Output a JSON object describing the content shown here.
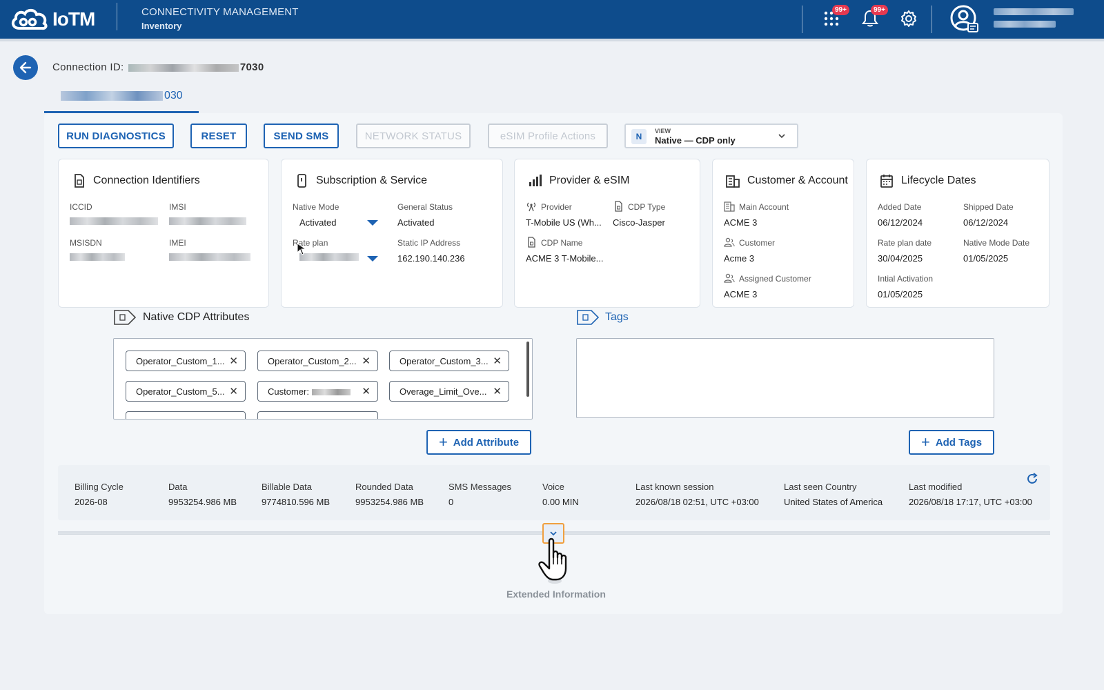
{
  "header": {
    "logo_text": "IoTM",
    "app_title": "CONNECTIVITY MANAGEMENT",
    "app_subtitle": "Inventory",
    "apps_badge": "99+",
    "notifications_badge": "99+",
    "brand_color": "#0e4c8c"
  },
  "page": {
    "connection_label": "Connection ID:",
    "connection_suffix": "7030",
    "tab_suffix": "030"
  },
  "actions": {
    "run_diagnostics": "RUN DIAGNOSTICS",
    "reset": "RESET",
    "send_sms": "SEND SMS",
    "network_status": "NETWORK STATUS",
    "esim_profile_actions": "eSIM Profile Actions",
    "view_badge": "N",
    "view_label": "VIEW",
    "view_value": "Native — CDP only"
  },
  "cards": {
    "identifiers": {
      "title": "Connection Identifiers",
      "iccid_label": "ICCID",
      "imsi_label": "IMSI",
      "msisdn_label": "MSISDN",
      "imei_label": "IMEI"
    },
    "subscription": {
      "title": "Subscription & Service",
      "native_mode_label": "Native Mode",
      "native_mode_value": "Activated",
      "general_status_label": "General Status",
      "general_status_value": "Activated",
      "rate_plan_label": "Rate plan",
      "static_ip_label": "Static IP Address",
      "static_ip_value": "162.190.140.236"
    },
    "provider": {
      "title": "Provider & eSIM",
      "provider_label": "Provider",
      "provider_value": "T-Mobile US (Wh...",
      "cdp_type_label": "CDP Type",
      "cdp_type_value": "Cisco-Jasper",
      "cdp_name_label": "CDP Name",
      "cdp_name_value": "ACME 3 T-Mobile..."
    },
    "customer": {
      "title": "Customer & Account",
      "main_account_label": "Main Account",
      "main_account_value": "ACME 3",
      "customer_label": "Customer",
      "customer_value": "Acme 3",
      "assigned_customer_label": "Assigned Customer",
      "assigned_customer_value": "ACME 3"
    },
    "lifecycle": {
      "title": "Lifecycle Dates",
      "added_date_label": "Added Date",
      "added_date_value": "06/12/2024",
      "shipped_date_label": "Shipped Date",
      "shipped_date_value": "06/12/2024",
      "rate_plan_date_label": "Rate plan date",
      "rate_plan_date_value": "30/04/2025",
      "native_mode_date_label": "Native Mode Date",
      "native_mode_date_value": "01/05/2025",
      "initial_activation_label": "Intial Activation",
      "initial_activation_value": "01/05/2025"
    }
  },
  "attributes": {
    "title": "Native CDP Attributes",
    "chips": [
      "Operator_Custom_1...",
      "Operator_Custom_2...",
      "Operator_Custom_3...",
      "Operator_Custom_5...",
      "Customer:",
      "Overage_Limit_Ove..."
    ],
    "add_label": "Add Attribute"
  },
  "tags": {
    "title": "Tags",
    "add_label": "Add Tags"
  },
  "stats": [
    {
      "label": "Billing Cycle",
      "value": "2026-08"
    },
    {
      "label": "Data",
      "value": "9953254.986 MB"
    },
    {
      "label": "Billable Data",
      "value": "9774810.596 MB"
    },
    {
      "label": "Rounded Data",
      "value": "9953254.986 MB"
    },
    {
      "label": "SMS Messages",
      "value": "0"
    },
    {
      "label": "Voice",
      "value": "0.00 MIN"
    },
    {
      "label": "Last known session",
      "value": "2026/08/18 02:51, UTC +03:00"
    },
    {
      "label": "Last seen Country",
      "value": "United States of America"
    },
    {
      "label": "Last modified",
      "value": "2026/08/18 17:17, UTC +03:00"
    }
  ],
  "extended": {
    "label": "Extended Information"
  }
}
